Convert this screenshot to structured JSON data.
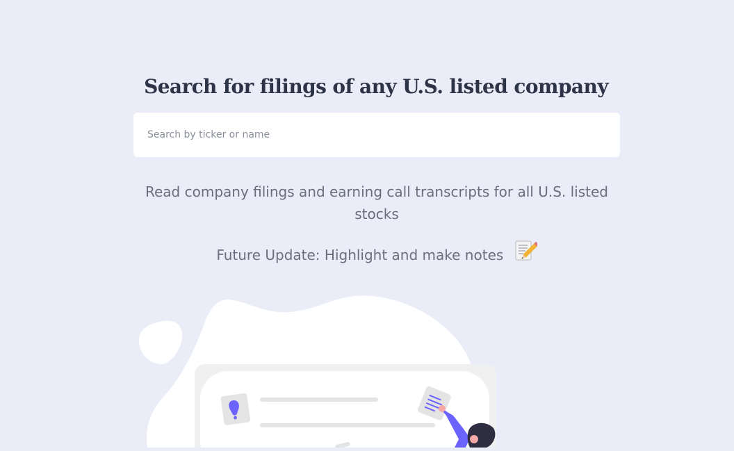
{
  "header": {
    "title": "Search for filings of any U.S. listed company"
  },
  "search": {
    "placeholder": "Search by ticker or name",
    "value": ""
  },
  "description": {
    "text": "Read company filings and earning call transcripts for all U.S. listed stocks"
  },
  "future_update": {
    "text": "Future Update: Highlight and make notes",
    "icon": "memo-icon"
  },
  "illustration": {
    "name": "document-review-illustration",
    "accent_color": "#6c63ff"
  },
  "colors": {
    "background": "#eaecf7",
    "title": "#2d3448",
    "body_text": "#6a6e7e",
    "accent": "#6c63ff"
  }
}
